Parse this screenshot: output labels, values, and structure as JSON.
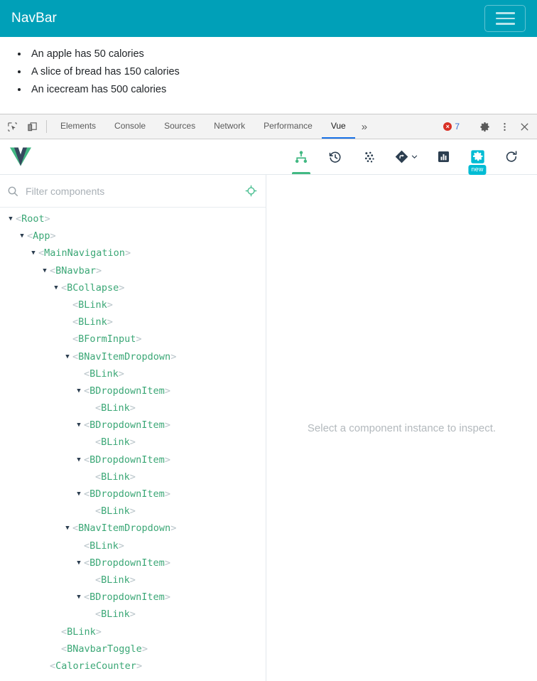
{
  "page": {
    "navbar": {
      "brand": "NavBar",
      "toggle_icon": "hamburger-icon"
    },
    "calorie_items": [
      "An apple has 50 calories",
      "A slice of bread has 150 calories",
      "An icecream has 500 calories"
    ]
  },
  "devtools": {
    "left_icons": [
      {
        "name": "inspect-element-icon"
      },
      {
        "name": "device-toolbar-icon"
      }
    ],
    "tabs": [
      {
        "label": "Elements",
        "active": false
      },
      {
        "label": "Console",
        "active": false
      },
      {
        "label": "Sources",
        "active": false
      },
      {
        "label": "Network",
        "active": false
      },
      {
        "label": "Performance",
        "active": false
      },
      {
        "label": "Vue",
        "active": true
      }
    ],
    "overflow_label": "»",
    "error_count": "7",
    "error_symbol": "×",
    "right_icons": [
      {
        "name": "gear-icon"
      },
      {
        "name": "kebab-menu-icon"
      },
      {
        "name": "close-icon"
      }
    ],
    "active_tab_accent": "#1a73e8",
    "error_color": "#d93025"
  },
  "vue_devtools": {
    "logo_name": "vue-logo",
    "accent": "#42b983",
    "header_actions": [
      {
        "name": "components-tree-icon",
        "active": true
      },
      {
        "name": "timeline-history-icon",
        "active": false
      },
      {
        "name": "vuex-icon",
        "active": false
      },
      {
        "name": "routing-icon",
        "active": false,
        "caret": true
      },
      {
        "name": "performance-chart-icon",
        "active": false
      },
      {
        "name": "settings-gear-icon",
        "active": false,
        "badge": "new"
      },
      {
        "name": "refresh-icon",
        "active": false
      }
    ],
    "filter": {
      "icon": "search-icon",
      "placeholder": "Filter components",
      "value": "",
      "select_icon": "target-crosshair-icon"
    },
    "detail_placeholder": "Select a component instance to inspect.",
    "tree": [
      {
        "depth": 0,
        "name": "Root",
        "expandable": true
      },
      {
        "depth": 1,
        "name": "App",
        "expandable": true
      },
      {
        "depth": 2,
        "name": "MainNavigation",
        "expandable": true
      },
      {
        "depth": 3,
        "name": "BNavbar",
        "expandable": true
      },
      {
        "depth": 4,
        "name": "BCollapse",
        "expandable": true
      },
      {
        "depth": 5,
        "name": "BLink",
        "expandable": false
      },
      {
        "depth": 5,
        "name": "BLink",
        "expandable": false
      },
      {
        "depth": 5,
        "name": "BFormInput",
        "expandable": false
      },
      {
        "depth": 5,
        "name": "BNavItemDropdown",
        "expandable": true
      },
      {
        "depth": 6,
        "name": "BLink",
        "expandable": false
      },
      {
        "depth": 6,
        "name": "BDropdownItem",
        "expandable": true
      },
      {
        "depth": 7,
        "name": "BLink",
        "expandable": false
      },
      {
        "depth": 6,
        "name": "BDropdownItem",
        "expandable": true
      },
      {
        "depth": 7,
        "name": "BLink",
        "expandable": false
      },
      {
        "depth": 6,
        "name": "BDropdownItem",
        "expandable": true
      },
      {
        "depth": 7,
        "name": "BLink",
        "expandable": false
      },
      {
        "depth": 6,
        "name": "BDropdownItem",
        "expandable": true
      },
      {
        "depth": 7,
        "name": "BLink",
        "expandable": false
      },
      {
        "depth": 5,
        "name": "BNavItemDropdown",
        "expandable": true
      },
      {
        "depth": 6,
        "name": "BLink",
        "expandable": false
      },
      {
        "depth": 6,
        "name": "BDropdownItem",
        "expandable": true
      },
      {
        "depth": 7,
        "name": "BLink",
        "expandable": false
      },
      {
        "depth": 6,
        "name": "BDropdownItem",
        "expandable": true
      },
      {
        "depth": 7,
        "name": "BLink",
        "expandable": false
      },
      {
        "depth": 4,
        "name": "BLink",
        "expandable": false
      },
      {
        "depth": 4,
        "name": "BNavbarToggle",
        "expandable": false
      },
      {
        "depth": 3,
        "name": "CalorieCounter",
        "expandable": false
      }
    ]
  }
}
